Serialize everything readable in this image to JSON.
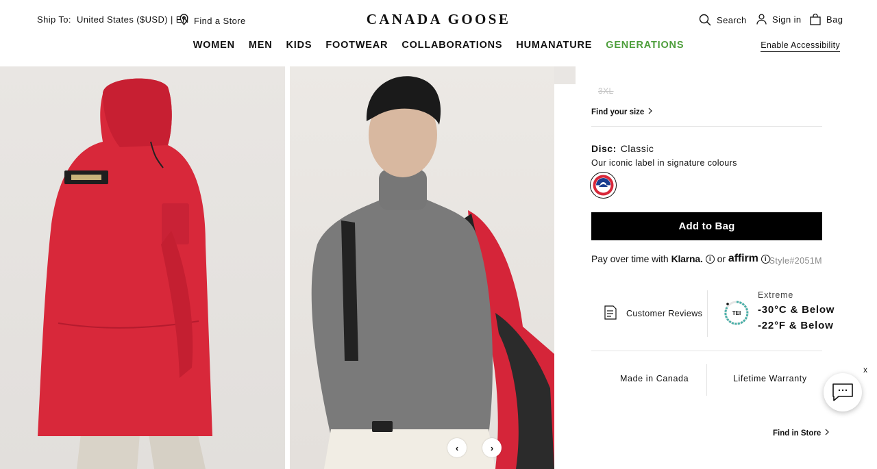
{
  "header": {
    "ship_label": "Ship To:",
    "ship_value": "United States ($USD) | EN",
    "find_store": "Find a Store",
    "logo": "CANADA GOOSE",
    "search": "Search",
    "sign_in": "Sign in",
    "bag": "Bag",
    "accessibility": "Enable Accessibility"
  },
  "nav": {
    "items": [
      "WOMEN",
      "MEN",
      "KIDS",
      "FOOTWEAR",
      "COLLABORATIONS",
      "HUMANATURE",
      "GENERATIONS"
    ],
    "accent_color": "#4d9e3b"
  },
  "gallery": {
    "prev": "‹",
    "next": "›"
  },
  "product": {
    "size_unavailable": "3XL",
    "find_size": "Find your size",
    "disc_label": "Disc:",
    "disc_value": "Classic",
    "disc_desc": "Our iconic label in signature colours",
    "add_to_bag": "Add to Bag",
    "pay_text": "Pay over time with",
    "klarna": "Klarna.",
    "or": "or",
    "affirm": "affirm",
    "style_no": "Style#2051M",
    "reviews": "Customer Reviews",
    "tei_label": "TEI",
    "temp_level": "Extreme",
    "temp_c": "-30°C & Below",
    "temp_f": "-22°F & Below",
    "made_in": "Made in Canada",
    "warranty": "Lifetime Warranty",
    "find_in_store": "Find in Store"
  },
  "chat": {
    "close": "x"
  }
}
